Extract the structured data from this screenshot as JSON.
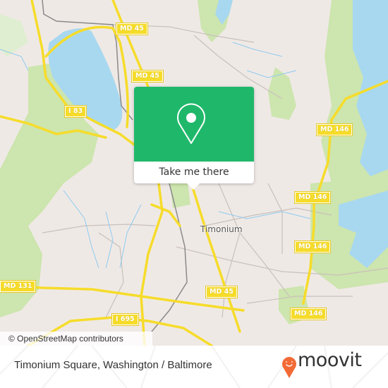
{
  "map": {
    "colors": {
      "land": "#efe9e6",
      "water": "#a8d8f0",
      "park": "#cde5ae",
      "road_major": "#f6dc2a",
      "road_minor": "#c8c0bb",
      "stream": "#8ecbee",
      "rail": "#8a8a8a"
    },
    "place_labels": [
      {
        "name": "Timonium"
      }
    ],
    "road_shields": [
      {
        "label": "MD 45"
      },
      {
        "label": "MD 45"
      },
      {
        "label": "I 83"
      },
      {
        "label": "MD 146"
      },
      {
        "label": "MD 146"
      },
      {
        "label": "MD 146"
      },
      {
        "label": "MD 146"
      },
      {
        "label": "MD 131"
      },
      {
        "label": "I 695"
      },
      {
        "label": "MD 45"
      }
    ],
    "attribution": "© OpenStreetMap contributors"
  },
  "popup": {
    "icon": "location-pin-icon",
    "button_label": "Take me there",
    "color": "#1fb86a"
  },
  "footer": {
    "title": "Timonium Square, Washington / Baltimore",
    "brand": "moovit",
    "brand_color": "#f26a36"
  }
}
